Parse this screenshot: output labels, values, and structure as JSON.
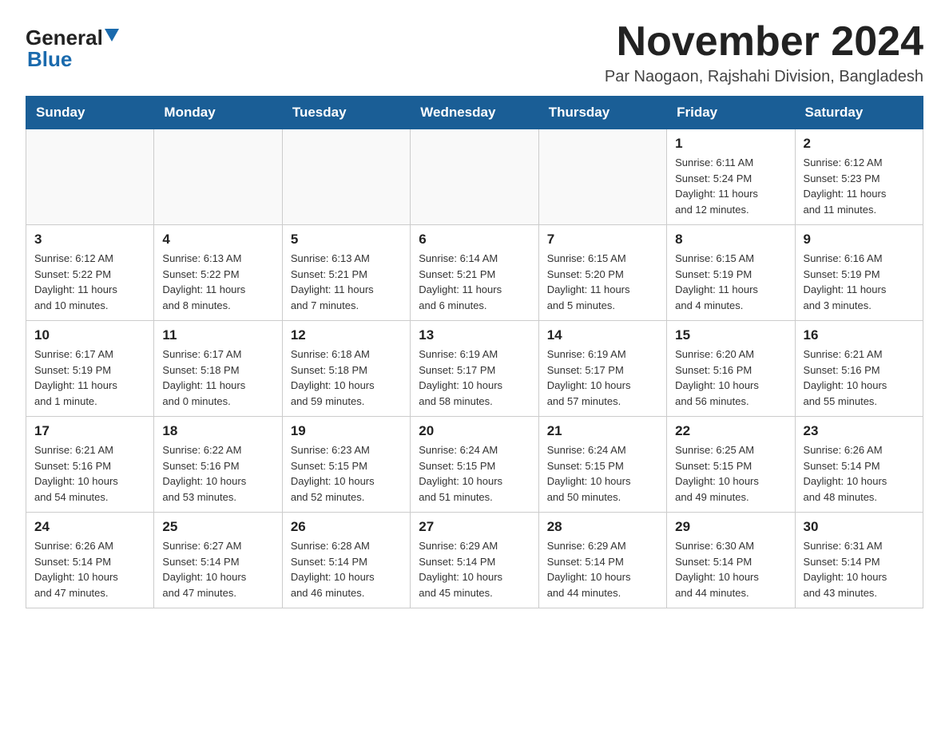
{
  "logo": {
    "general": "General",
    "blue": "Blue",
    "triangle_color": "#1a6aad"
  },
  "header": {
    "month_year": "November 2024",
    "location": "Par Naogaon, Rajshahi Division, Bangladesh"
  },
  "weekdays": [
    "Sunday",
    "Monday",
    "Tuesday",
    "Wednesday",
    "Thursday",
    "Friday",
    "Saturday"
  ],
  "weeks": [
    {
      "days": [
        {
          "number": "",
          "info": ""
        },
        {
          "number": "",
          "info": ""
        },
        {
          "number": "",
          "info": ""
        },
        {
          "number": "",
          "info": ""
        },
        {
          "number": "",
          "info": ""
        },
        {
          "number": "1",
          "info": "Sunrise: 6:11 AM\nSunset: 5:24 PM\nDaylight: 11 hours\nand 12 minutes."
        },
        {
          "number": "2",
          "info": "Sunrise: 6:12 AM\nSunset: 5:23 PM\nDaylight: 11 hours\nand 11 minutes."
        }
      ]
    },
    {
      "days": [
        {
          "number": "3",
          "info": "Sunrise: 6:12 AM\nSunset: 5:22 PM\nDaylight: 11 hours\nand 10 minutes."
        },
        {
          "number": "4",
          "info": "Sunrise: 6:13 AM\nSunset: 5:22 PM\nDaylight: 11 hours\nand 8 minutes."
        },
        {
          "number": "5",
          "info": "Sunrise: 6:13 AM\nSunset: 5:21 PM\nDaylight: 11 hours\nand 7 minutes."
        },
        {
          "number": "6",
          "info": "Sunrise: 6:14 AM\nSunset: 5:21 PM\nDaylight: 11 hours\nand 6 minutes."
        },
        {
          "number": "7",
          "info": "Sunrise: 6:15 AM\nSunset: 5:20 PM\nDaylight: 11 hours\nand 5 minutes."
        },
        {
          "number": "8",
          "info": "Sunrise: 6:15 AM\nSunset: 5:19 PM\nDaylight: 11 hours\nand 4 minutes."
        },
        {
          "number": "9",
          "info": "Sunrise: 6:16 AM\nSunset: 5:19 PM\nDaylight: 11 hours\nand 3 minutes."
        }
      ]
    },
    {
      "days": [
        {
          "number": "10",
          "info": "Sunrise: 6:17 AM\nSunset: 5:19 PM\nDaylight: 11 hours\nand 1 minute."
        },
        {
          "number": "11",
          "info": "Sunrise: 6:17 AM\nSunset: 5:18 PM\nDaylight: 11 hours\nand 0 minutes."
        },
        {
          "number": "12",
          "info": "Sunrise: 6:18 AM\nSunset: 5:18 PM\nDaylight: 10 hours\nand 59 minutes."
        },
        {
          "number": "13",
          "info": "Sunrise: 6:19 AM\nSunset: 5:17 PM\nDaylight: 10 hours\nand 58 minutes."
        },
        {
          "number": "14",
          "info": "Sunrise: 6:19 AM\nSunset: 5:17 PM\nDaylight: 10 hours\nand 57 minutes."
        },
        {
          "number": "15",
          "info": "Sunrise: 6:20 AM\nSunset: 5:16 PM\nDaylight: 10 hours\nand 56 minutes."
        },
        {
          "number": "16",
          "info": "Sunrise: 6:21 AM\nSunset: 5:16 PM\nDaylight: 10 hours\nand 55 minutes."
        }
      ]
    },
    {
      "days": [
        {
          "number": "17",
          "info": "Sunrise: 6:21 AM\nSunset: 5:16 PM\nDaylight: 10 hours\nand 54 minutes."
        },
        {
          "number": "18",
          "info": "Sunrise: 6:22 AM\nSunset: 5:16 PM\nDaylight: 10 hours\nand 53 minutes."
        },
        {
          "number": "19",
          "info": "Sunrise: 6:23 AM\nSunset: 5:15 PM\nDaylight: 10 hours\nand 52 minutes."
        },
        {
          "number": "20",
          "info": "Sunrise: 6:24 AM\nSunset: 5:15 PM\nDaylight: 10 hours\nand 51 minutes."
        },
        {
          "number": "21",
          "info": "Sunrise: 6:24 AM\nSunset: 5:15 PM\nDaylight: 10 hours\nand 50 minutes."
        },
        {
          "number": "22",
          "info": "Sunrise: 6:25 AM\nSunset: 5:15 PM\nDaylight: 10 hours\nand 49 minutes."
        },
        {
          "number": "23",
          "info": "Sunrise: 6:26 AM\nSunset: 5:14 PM\nDaylight: 10 hours\nand 48 minutes."
        }
      ]
    },
    {
      "days": [
        {
          "number": "24",
          "info": "Sunrise: 6:26 AM\nSunset: 5:14 PM\nDaylight: 10 hours\nand 47 minutes."
        },
        {
          "number": "25",
          "info": "Sunrise: 6:27 AM\nSunset: 5:14 PM\nDaylight: 10 hours\nand 47 minutes."
        },
        {
          "number": "26",
          "info": "Sunrise: 6:28 AM\nSunset: 5:14 PM\nDaylight: 10 hours\nand 46 minutes."
        },
        {
          "number": "27",
          "info": "Sunrise: 6:29 AM\nSunset: 5:14 PM\nDaylight: 10 hours\nand 45 minutes."
        },
        {
          "number": "28",
          "info": "Sunrise: 6:29 AM\nSunset: 5:14 PM\nDaylight: 10 hours\nand 44 minutes."
        },
        {
          "number": "29",
          "info": "Sunrise: 6:30 AM\nSunset: 5:14 PM\nDaylight: 10 hours\nand 44 minutes."
        },
        {
          "number": "30",
          "info": "Sunrise: 6:31 AM\nSunset: 5:14 PM\nDaylight: 10 hours\nand 43 minutes."
        }
      ]
    }
  ]
}
